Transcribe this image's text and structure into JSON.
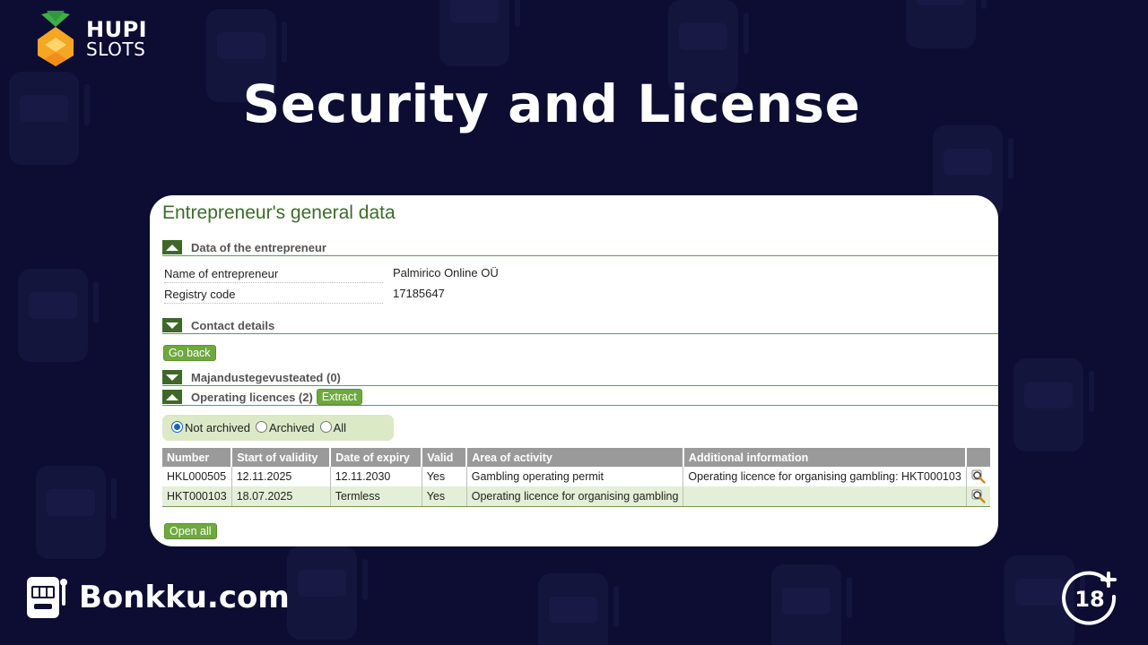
{
  "brand_top": {
    "line1": "HUPI",
    "line2": "SLOTS"
  },
  "page_title": "Security and License",
  "card": {
    "heading": "Entrepreneur's general data",
    "sections": {
      "entrepreneur": "Data of the entrepreneur",
      "contact": "Contact details",
      "majandus": "Majandustegevusteated (0)",
      "licences": "Operating licences (2)"
    },
    "fields": [
      {
        "label": "Name of entrepreneur",
        "value": "Palmirico Online OÜ"
      },
      {
        "label": "Registry code",
        "value": "17185647"
      }
    ],
    "go_back_label": "Go back",
    "extract_label": "Extract",
    "filter": {
      "not_archived": "Not archived",
      "archived": "Archived",
      "all": "All",
      "selected": "Not archived"
    },
    "table": {
      "headers": [
        "Number",
        "Start of validity",
        "Date of expiry",
        "Valid",
        "Area of activity",
        "Additional information",
        ""
      ],
      "rows": [
        [
          "HKL000505",
          "12.11.2025",
          "12.11.2030",
          "Yes",
          "Gambling operating permit",
          "Operating licence for organising gambling: HKT000103"
        ],
        [
          "HKT000103",
          "18.07.2025",
          "Termless",
          "Yes",
          "Operating licence for organising gambling",
          ""
        ]
      ]
    },
    "open_all_label": "Open all"
  },
  "footer": {
    "site": "Bonkku.com",
    "age": "18"
  },
  "colors": {
    "background": "#0d0d33",
    "accent_green": "#6fa83f",
    "heading_green": "#3d6b2c",
    "logo_orange": "#f5a623"
  }
}
